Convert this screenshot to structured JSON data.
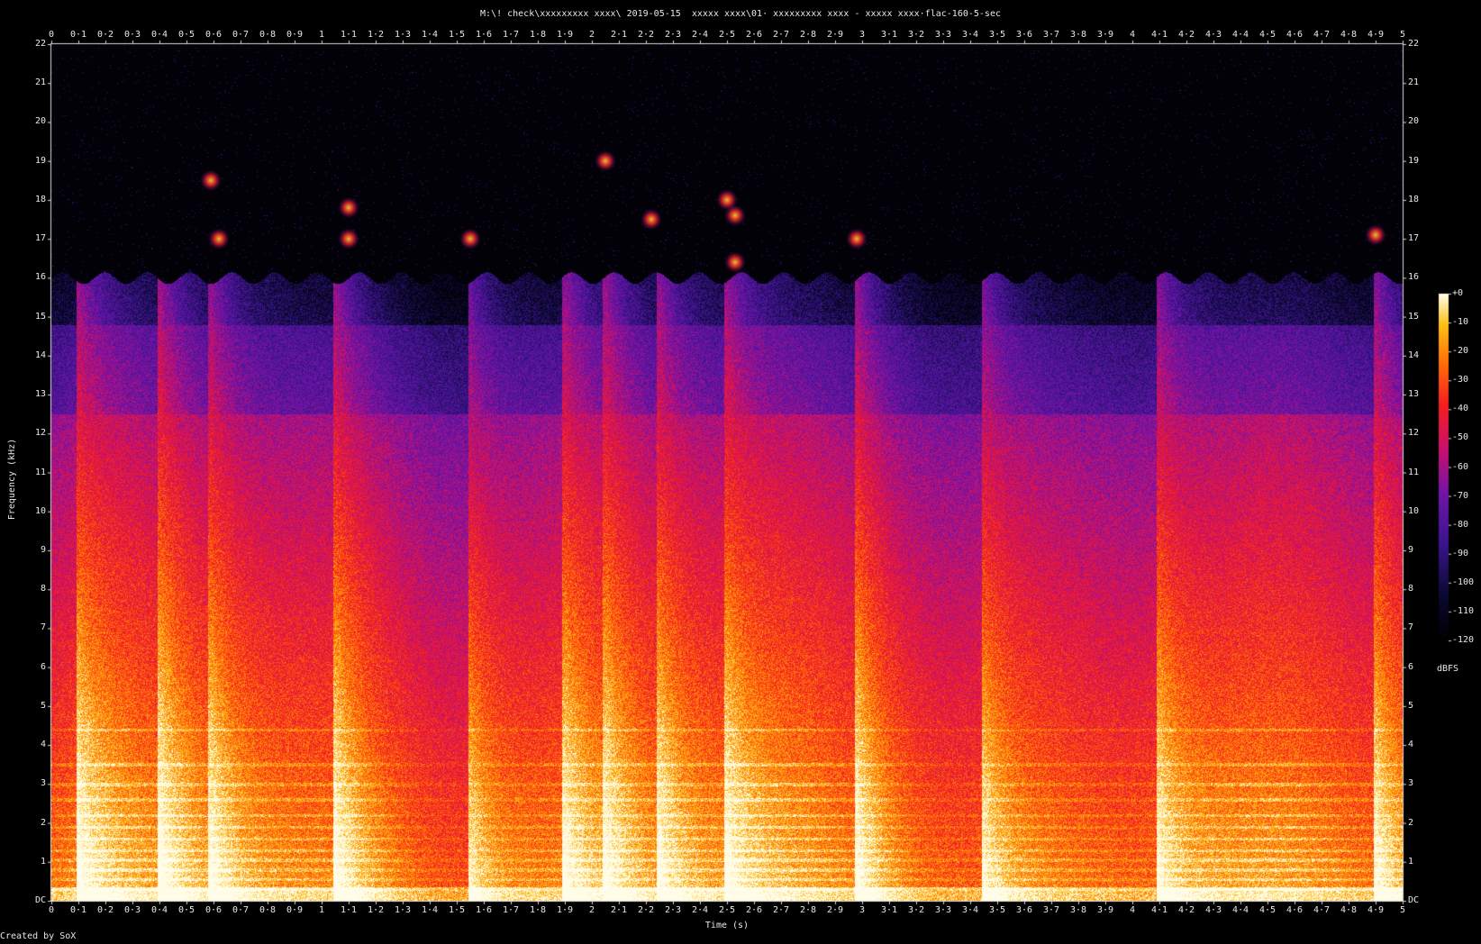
{
  "title": "M:\\! check\\xxxxxxxxx xxxx\\ 2019-05-15  xxxxx xxxx\\01· xxxxxxxxx xxxx - xxxxx xxxx·flac-160-5-sec",
  "credit": "Created by SoX",
  "chart_data": {
    "type": "heatmap",
    "title": "M:\\! check\\xxxxxxxxx xxxx\\ 2019-05-15  xxxxx xxxx\\01· xxxxxxxxx xxxx - xxxxx xxxx·flac-160-5-sec",
    "xlabel": "Time (s)",
    "ylabel": "Frequency (kHz)",
    "xlim": [
      0,
      5
    ],
    "ylim": [
      0,
      22
    ],
    "x_tick_labels": [
      "0",
      "0·1",
      "0·2",
      "0·3",
      "0·4",
      "0·5",
      "0·6",
      "0·7",
      "0·8",
      "0·9",
      "1",
      "1·1",
      "1·2",
      "1·3",
      "1·4",
      "1·5",
      "1·6",
      "1·7",
      "1·8",
      "1·9",
      "2",
      "2·1",
      "2·2",
      "2·3",
      "2·4",
      "2·5",
      "2·6",
      "2·7",
      "2·8",
      "2·9",
      "3",
      "3·1",
      "3·2",
      "3·3",
      "3·4",
      "3·5",
      "3·6",
      "3·7",
      "3·8",
      "3·9",
      "4",
      "4·1",
      "4·2",
      "4·3",
      "4·4",
      "4·5",
      "4·6",
      "4·7",
      "4·8",
      "4·9",
      "5"
    ],
    "y_tick_labels": [
      "DC",
      "1",
      "2",
      "3",
      "4",
      "5",
      "6",
      "7",
      "8",
      "9",
      "10",
      "11",
      "12",
      "13",
      "14",
      "15",
      "16",
      "17",
      "18",
      "19",
      "20",
      "21",
      "22"
    ],
    "colorbar": {
      "label": "dBFS",
      "range": [
        -120,
        0
      ],
      "tick_labels": [
        "+0",
        "-10",
        "-20",
        "-30",
        "-40",
        "-50",
        "-60",
        "-70",
        "-80",
        "-90",
        "-100",
        "-110",
        "-120"
      ]
    },
    "lowpass_cutoff_khz": 16,
    "transients_s": [
      0.1,
      0.4,
      0.59,
      1.05,
      1.55,
      1.9,
      2.05,
      2.25,
      2.5,
      2.98,
      3.45,
      4.1,
      4.9
    ],
    "colors": {
      "background": "#000000",
      "low": "#0b0830",
      "mid_low": "#5a1ab0",
      "mid": "#d0106a",
      "mid_high": "#ff2a10",
      "high": "#ffb000",
      "max": "#fffde8"
    }
  }
}
